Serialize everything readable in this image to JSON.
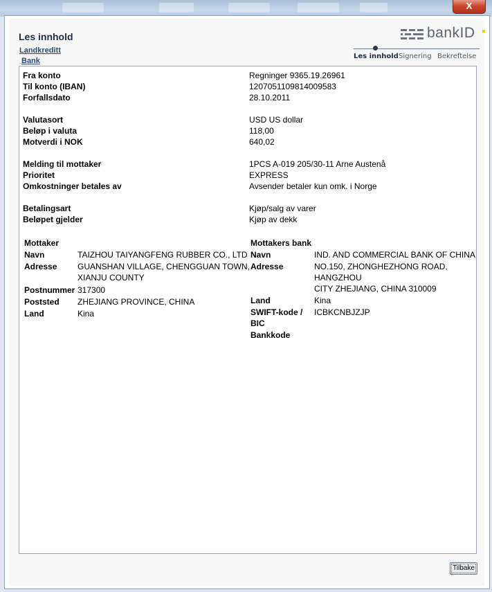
{
  "window": {
    "close_label": "X"
  },
  "header": {
    "title": "Les innhold",
    "links": [
      "Landkreditt",
      "Bank"
    ],
    "logo_text": "bankID",
    "steps": [
      "Les innhold",
      "Signering",
      "Bekreftelse"
    ]
  },
  "payment": {
    "fra_konto_label": "Fra konto",
    "fra_konto": "Regninger 9365.19.26961",
    "til_konto_label": "Til konto (IBAN)",
    "til_konto": "1207051109814009583",
    "forfallsdato_label": "Forfallsdato",
    "forfallsdato": "28.10.2011",
    "valutasort_label": "Valutasort",
    "valutasort": "USD US dollar",
    "belop_label": "Beløp i valuta",
    "belop": "118,00",
    "motverdi_label": "Motverdi i NOK",
    "motverdi": "640,02",
    "melding_label": "Melding til mottaker",
    "melding": "1PCS A-019 205/30-11 Arne Austenå",
    "prioritet_label": "Prioritet",
    "prioritet": "EXPRESS",
    "omkostninger_label": "Omkostninger betales av",
    "omkostninger": "Avsender betaler kun omk. i Norge",
    "betalingsart_label": "Betalingsart",
    "betalingsart": "Kjøp/salg av varer",
    "gjelder_label": "Beløpet gjelder",
    "gjelder": "Kjøp av dekk"
  },
  "mottaker": {
    "heading": "Mottaker",
    "navn_label": "Navn",
    "navn": "TAIZHOU TAIYANGFENG RUBBER CO., LTD",
    "adresse_label": "Adresse",
    "adresse_1": "GUANSHAN VILLAGE, CHENGGUAN TOWN,",
    "adresse_2": "XIANJU COUNTY",
    "postnummer_label": "Postnummer",
    "postnummer": "317300",
    "poststed_label": "Poststed",
    "poststed": "ZHEJIANG PROVINCE, CHINA",
    "land_label": "Land",
    "land": "Kina"
  },
  "bank": {
    "heading": "Mottakers bank",
    "navn_label": "Navn",
    "navn": "IND. AND COMMERCIAL BANK OF CHINA",
    "adresse_label": "Adresse",
    "adresse_1": "NO.150, ZHONGHEZHONG ROAD,",
    "adresse_2": "HANGZHOU",
    "adresse_3": "CITY ZHEJIANG, CHINA 310009",
    "land_label": "Land",
    "land": "Kina",
    "swift_label_1": "SWIFT-kode /",
    "swift_label_2": "BIC",
    "swift": "ICBKCNBJZJP",
    "bankkode_label": "Bankkode"
  },
  "footer": {
    "back_label": "Tilbake"
  }
}
